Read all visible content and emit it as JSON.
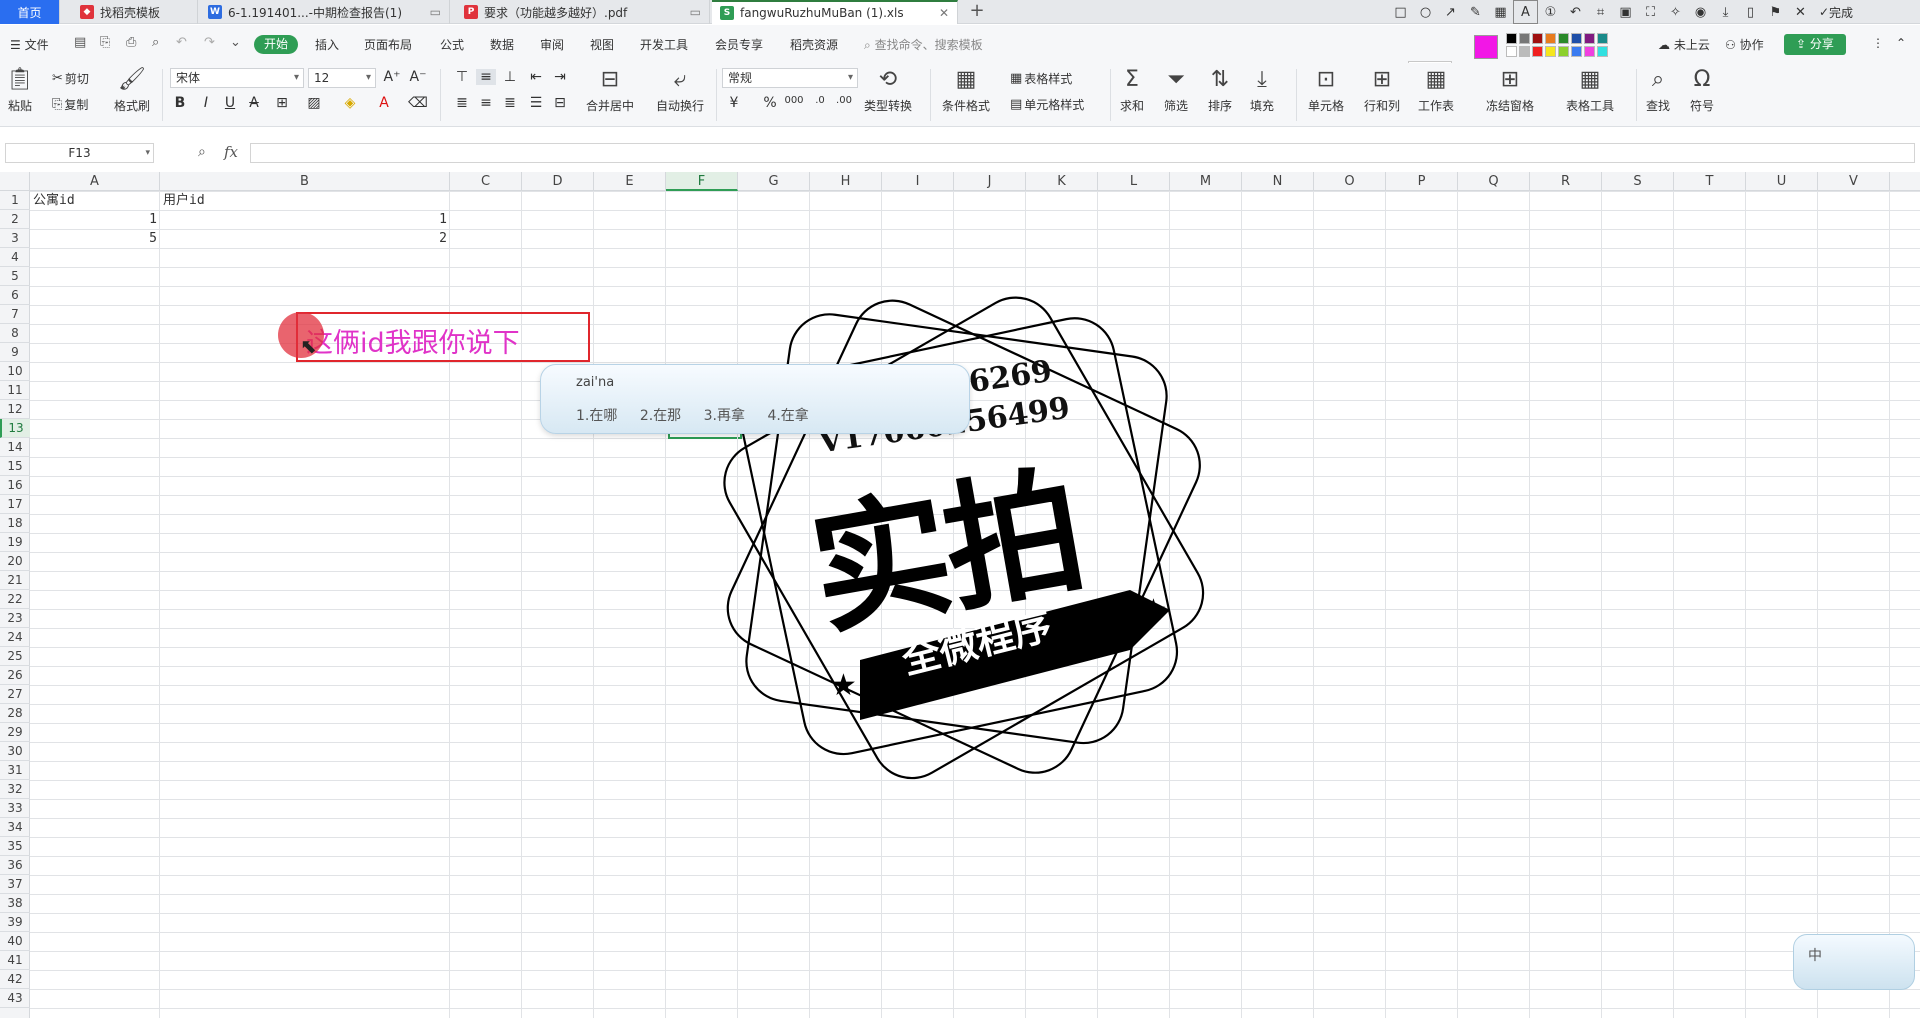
{
  "tabs": {
    "home": "首页",
    "t1": "找稻壳模板",
    "t2": "6-1.191401...-中期检查报告(1)",
    "t3": "要求（功能越多越好）.pdf",
    "t4": "fangwuRuzhuMuBan (1).xls"
  },
  "draw_toolbar": {
    "done": "完成",
    "font_size": "22"
  },
  "menu": {
    "file": "文件",
    "start": "开始",
    "insert": "插入",
    "page_layout": "页面布局",
    "formula": "公式",
    "data": "数据",
    "review": "审阅",
    "view": "视图",
    "dev_tools": "开发工具",
    "member": "会员专享",
    "daoke": "稻壳资源",
    "search_cmd": "查找命令、搜索模板",
    "cloud": "未上云",
    "collab": "协作",
    "share": "分享"
  },
  "ribbon": {
    "paste": "粘贴",
    "cut": "剪切",
    "copy": "复制",
    "format_painter": "格式刷",
    "font_name": "宋体",
    "font_size": "12",
    "merge_center": "合并居中",
    "wrap": "自动换行",
    "number_format": "常规",
    "type_convert": "类型转换",
    "cond_format": "条件格式",
    "table_style": "表格样式",
    "cell_style": "单元格样式",
    "sum": "求和",
    "filter": "筛选",
    "sort": "排序",
    "fill": "填充",
    "cell": "单元格",
    "row_col": "行和列",
    "worksheet": "工作表",
    "freeze": "冻结窗格",
    "table_tools": "表格工具",
    "find": "查找",
    "symbol": "符号"
  },
  "formula_bar": {
    "name_box": "F13",
    "fx": "fx",
    "value": ""
  },
  "columns": [
    "A",
    "B",
    "C",
    "D",
    "E",
    "F",
    "G",
    "H",
    "I",
    "J",
    "K",
    "L",
    "M",
    "N",
    "O",
    "P",
    "Q",
    "R",
    "S",
    "T",
    "U",
    "V"
  ],
  "active_column": "F",
  "active_row": 13,
  "cells": {
    "A1": "公寓id",
    "B1": "用户id",
    "A2": "1",
    "B2": "1",
    "A3": "5",
    "B3": "2"
  },
  "annotation": {
    "text": "这俩id我跟你说下"
  },
  "ime": {
    "composition": "zai'na",
    "candidates": [
      "1.在哪",
      "2.在那",
      "3.再拿",
      "4.在拿"
    ],
    "mode": "中"
  },
  "watermark": {
    "qq": "Q2196316269",
    "phone": "V17060256499",
    "main": "实拍",
    "banner": "全微程序"
  }
}
